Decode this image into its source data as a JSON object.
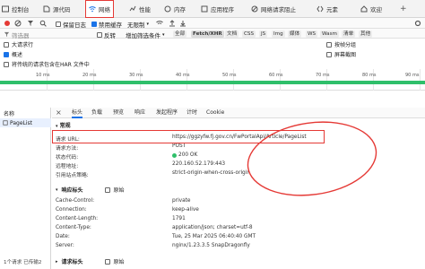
{
  "toolbar": {
    "tabs": [
      {
        "label": "控制台",
        "icon": "console-icon"
      },
      {
        "label": "源代码",
        "icon": "sources-icon"
      },
      {
        "label": "网络",
        "icon": "wifi-icon",
        "active": true
      },
      {
        "label": "性能",
        "icon": "performance-icon"
      },
      {
        "label": "内存",
        "icon": "memory-icon"
      },
      {
        "label": "应用程序",
        "icon": "application-icon"
      },
      {
        "label": "网络请求阻止",
        "icon": "request-block-icon"
      },
      {
        "label": "元素",
        "icon": "elements-icon"
      },
      {
        "label": "欢迎",
        "icon": "home-icon"
      }
    ]
  },
  "network_options": {
    "preserve_log": "保留日志",
    "disable_cache": "禁用缓存",
    "throttle": "无限制"
  },
  "filter": {
    "placeholder": "筛选器",
    "invert": "反转",
    "more_filters": "增加筛选条件",
    "types": [
      "全部",
      "Fetch/XHR",
      "文档",
      "CSS",
      "JS",
      "Img",
      "媒体",
      "WS",
      "Wasm",
      "清单",
      "其他"
    ]
  },
  "options": {
    "left": [
      "大请求行",
      "概述",
      "将传统的请求包含在HAR 文件中"
    ],
    "right": [
      "按帧分组",
      "屏幕截图"
    ]
  },
  "timeline_ticks": [
    "10 ms",
    "20 ms",
    "30 ms",
    "40 ms",
    "50 ms",
    "60 ms",
    "70 ms",
    "80 ms",
    "90 ms"
  ],
  "left_panel": {
    "header": "名称",
    "item": "PageList",
    "status": "1个请求  已传输2"
  },
  "detail": {
    "tabs": [
      "标头",
      "负载",
      "预览",
      "响应",
      "发起程序",
      "计时",
      "Cookie"
    ],
    "general_title": "常规",
    "general": [
      {
        "k": "请求 URL:",
        "v": "https://ggzyfw.fj.gov.cn/FwPortalApi/Article/PageList"
      },
      {
        "k": "请求方法:",
        "v": "POST"
      },
      {
        "k": "状态代码:",
        "v": "200 OK"
      },
      {
        "k": "远程地址:",
        "v": "220.160.52.179:443"
      },
      {
        "k": "引用站点策略:",
        "v": "strict-origin-when-cross-origin"
      }
    ],
    "response_title": "响应标头",
    "raw": "原始",
    "response": [
      {
        "k": "Cache-Control:",
        "v": "private"
      },
      {
        "k": "Connection:",
        "v": "keep-alive"
      },
      {
        "k": "Content-Length:",
        "v": "1791"
      },
      {
        "k": "Content-Type:",
        "v": "application/json; charset=utf-8"
      },
      {
        "k": "Date:",
        "v": "Tue, 25 Mar 2025 06:40:40 GMT"
      },
      {
        "k": "Server:",
        "v": "nginx/1.23.3.5 SnapDragonfly"
      }
    ],
    "request_title": "请求标头"
  },
  "colors": {
    "accent": "#1a73e8",
    "highlight": "#e53935",
    "timeline": "#2fbf6a"
  }
}
